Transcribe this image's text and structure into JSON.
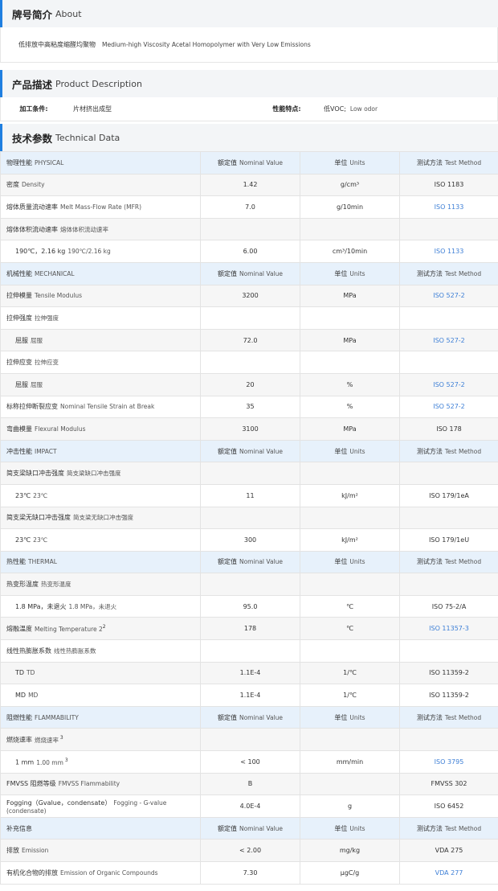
{
  "about": {
    "title_zh": "牌号简介",
    "title_en": "About",
    "text_zh": "低排放中高粘度缩醛均聚物",
    "text_en": "Medium-high Viscosity Acetal Homopolymer with Very Low Emissions"
  },
  "description": {
    "title_zh": "产品描述",
    "title_en": "Product Description",
    "processing_label": "加工条件:",
    "processing_value": "片材挤出成型",
    "feature_label": "性能特点:",
    "feature_value_zh": "低VOC;",
    "feature_value_en": "Low odor"
  },
  "tech": {
    "title_zh": "技术参数",
    "title_en": "Technical Data",
    "col_nominal_zh": "额定值",
    "col_nominal_en": "Nominal Value",
    "col_unit_zh": "单位",
    "col_unit_en": "Units",
    "col_method_zh": "测试方法",
    "col_method_en": "Test Method"
  },
  "groups": [
    {
      "zh": "物理性能",
      "en": "PHYSICAL",
      "rows": [
        {
          "zh": "密度",
          "en": "Density",
          "value": "1.42",
          "unit": "g/cm³",
          "method": "ISO 1183",
          "link": false,
          "indent": false,
          "sup": ""
        },
        {
          "zh": "熔体质量流动速率",
          "en": "Melt Mass-Flow Rate (MFR)",
          "value": "7.0",
          "unit": "g/10min",
          "method": "ISO 1133",
          "link": true,
          "indent": false,
          "sup": ""
        },
        {
          "zh": "熔体体积流动速率",
          "en": "熔体体积流动速率",
          "value": "",
          "unit": "",
          "method": "",
          "link": false,
          "indent": false,
          "sup": ""
        },
        {
          "zh": "190℃，2.16 kg",
          "en": "190℃/2.16 kg",
          "value": "6.00",
          "unit": "cm³/10min",
          "method": "ISO 1133",
          "link": true,
          "indent": true,
          "sup": ""
        }
      ]
    },
    {
      "zh": "机械性能",
      "en": "MECHANICAL",
      "rows": [
        {
          "zh": "拉伸模量",
          "en": "Tensile Modulus",
          "value": "3200",
          "unit": "MPa",
          "method": "ISO 527-2",
          "link": true,
          "indent": false,
          "sup": ""
        },
        {
          "zh": "拉伸强度",
          "en": "拉伸强度",
          "value": "",
          "unit": "",
          "method": "",
          "link": false,
          "indent": false,
          "sup": ""
        },
        {
          "zh": "屈服",
          "en": "屈服",
          "value": "72.0",
          "unit": "MPa",
          "method": "ISO 527-2",
          "link": true,
          "indent": true,
          "sup": ""
        },
        {
          "zh": "拉伸应变",
          "en": "拉伸应变",
          "value": "",
          "unit": "",
          "method": "",
          "link": false,
          "indent": false,
          "sup": ""
        },
        {
          "zh": "屈服",
          "en": "屈服",
          "value": "20",
          "unit": "%",
          "method": "ISO 527-2",
          "link": true,
          "indent": true,
          "sup": ""
        },
        {
          "zh": "标称拉伸断裂应变",
          "en": "Nominal Tensile Strain at Break",
          "value": "35",
          "unit": "%",
          "method": "ISO 527-2",
          "link": true,
          "indent": false,
          "sup": ""
        },
        {
          "zh": "弯曲模量",
          "en": "Flexural Modulus",
          "value": "3100",
          "unit": "MPa",
          "method": "ISO 178",
          "link": false,
          "indent": false,
          "sup": ""
        }
      ]
    },
    {
      "zh": "冲击性能",
      "en": "IMPACT",
      "rows": [
        {
          "zh": "简支梁缺口冲击强度",
          "en": "简支梁缺口冲击强度",
          "value": "",
          "unit": "",
          "method": "",
          "link": false,
          "indent": false,
          "sup": ""
        },
        {
          "zh": "23℃",
          "en": "23℃",
          "value": "11",
          "unit": "kJ/m²",
          "method": "ISO 179/1eA",
          "link": false,
          "indent": true,
          "sup": ""
        },
        {
          "zh": "简支梁无缺口冲击强度",
          "en": "简支梁无缺口冲击强度",
          "value": "",
          "unit": "",
          "method": "",
          "link": false,
          "indent": false,
          "sup": ""
        },
        {
          "zh": "23℃",
          "en": "23℃",
          "value": "300",
          "unit": "kJ/m²",
          "method": "ISO 179/1eU",
          "link": false,
          "indent": true,
          "sup": ""
        }
      ]
    },
    {
      "zh": "热性能",
      "en": "THERMAL",
      "rows": [
        {
          "zh": "热变形温度",
          "en": "热变形温度",
          "value": "",
          "unit": "",
          "method": "",
          "link": false,
          "indent": false,
          "sup": ""
        },
        {
          "zh": "1.8 MPa，未退火",
          "en": "1.8 MPa，未退火",
          "value": "95.0",
          "unit": "℃",
          "method": "ISO 75-2/A",
          "link": false,
          "indent": true,
          "sup": ""
        },
        {
          "zh": "熔融温度",
          "en": "Melting Temperature  2",
          "value": "178",
          "unit": "℃",
          "method": "ISO 11357-3",
          "link": true,
          "indent": false,
          "sup": "2"
        },
        {
          "zh": "线性热膨胀系数",
          "en": "线性热膨胀系数",
          "value": "",
          "unit": "",
          "method": "",
          "link": false,
          "indent": false,
          "sup": ""
        },
        {
          "zh": "TD",
          "en": "TD",
          "value": "1.1E-4",
          "unit": "1/℃",
          "method": "ISO 11359-2",
          "link": false,
          "indent": true,
          "sup": ""
        },
        {
          "zh": "MD",
          "en": "MD",
          "value": "1.1E-4",
          "unit": "1/℃",
          "method": "ISO 11359-2",
          "link": false,
          "indent": true,
          "sup": ""
        }
      ]
    },
    {
      "zh": "阻燃性能",
      "en": "FLAMMABILITY",
      "rows": [
        {
          "zh": "燃烧速率",
          "en": "燃烧速率",
          "value": "",
          "unit": "",
          "method": "",
          "link": false,
          "indent": false,
          "sup": "3"
        },
        {
          "zh": "1 mm",
          "en": "1.00 mm",
          "value": "< 100",
          "unit": "mm/min",
          "method": "ISO 3795",
          "link": true,
          "indent": true,
          "sup": "3"
        },
        {
          "zh": "FMVSS 阻燃等级",
          "en": "FMVSS Flammability",
          "value": "B",
          "unit": "",
          "method": "FMVSS 302",
          "link": false,
          "indent": false,
          "sup": ""
        },
        {
          "zh": "Fogging（Gvalue，condensate）",
          "en": "Fogging - G-value (condensate)",
          "value": "4.0E-4",
          "unit": "g",
          "method": "ISO 6452",
          "link": false,
          "indent": false,
          "sup": ""
        }
      ]
    },
    {
      "zh": "补充信息",
      "en": "",
      "rows": [
        {
          "zh": "排放",
          "en": "Emission",
          "value": "< 2.00",
          "unit": "mg/kg",
          "method": "VDA 275",
          "link": false,
          "indent": false,
          "sup": ""
        },
        {
          "zh": "有机化合物的排放",
          "en": "Emission of Organic Compounds",
          "value": "7.30",
          "unit": "μgC/g",
          "method": "VDA 277",
          "link": true,
          "indent": false,
          "sup": ""
        }
      ]
    }
  ]
}
